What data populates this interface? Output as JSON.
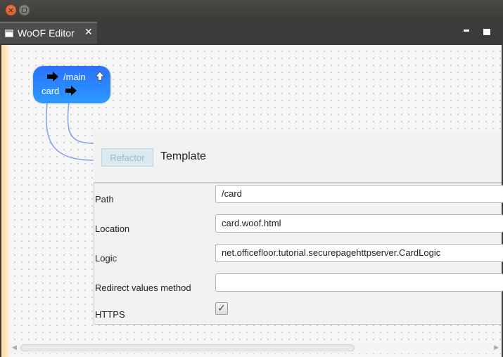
{
  "window": {
    "close_glyph": "×"
  },
  "tab": {
    "title": "WoOF Editor",
    "close_glyph": "✕",
    "icon": "editor-file-icon"
  },
  "node": {
    "main_label": "/main",
    "card_label": "card"
  },
  "panel": {
    "refactor_label": "Refactor",
    "title": "Template",
    "properties": [
      {
        "label": "Path",
        "value": "/card"
      },
      {
        "label": "Location",
        "value": "card.woof.html"
      },
      {
        "label": "Logic",
        "value": "net.officefloor.tutorial.securepagehttpserver.CardLogic"
      },
      {
        "label": "Redirect values method",
        "value": ""
      }
    ],
    "https_label": "HTTPS",
    "https_checked": true,
    "check_glyph": "✓"
  },
  "scrollbar": {
    "left_glyph": "◀",
    "right_glyph": "▶"
  },
  "colors": {
    "node_blue": "#2a7fff",
    "link_line": "#7f9fe8",
    "title_close": "#df4a16"
  }
}
